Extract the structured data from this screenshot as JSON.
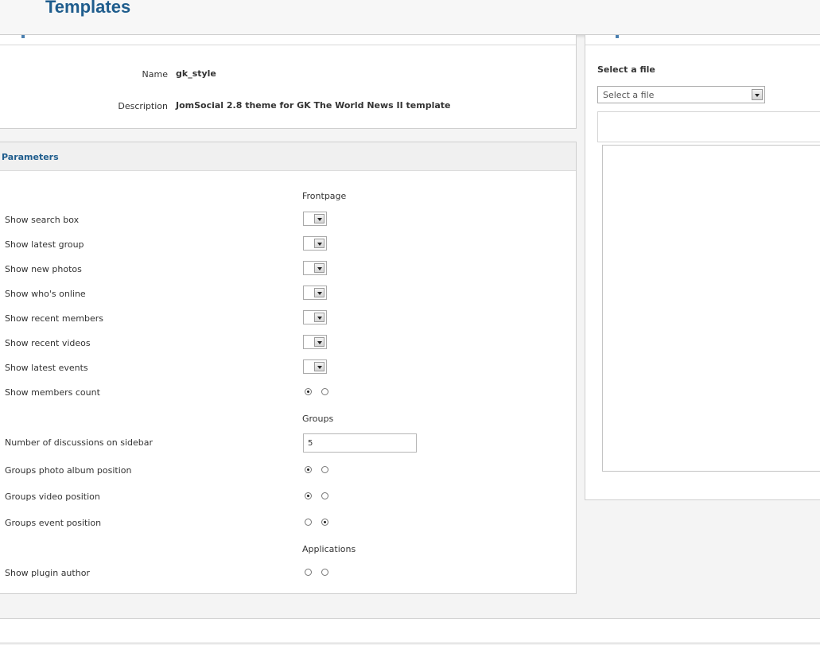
{
  "header": {
    "title": "Templates"
  },
  "details": {
    "name_label": "Name",
    "name_value": "gk_style",
    "description_label": "Description",
    "description_value": "JomSocial 2.8 theme for GK The World News II template"
  },
  "parameters": {
    "title": "Parameters",
    "frontpage_heading": "Frontpage",
    "frontpage": [
      {
        "label": "Show search box",
        "control": "select"
      },
      {
        "label": "Show latest group",
        "control": "select"
      },
      {
        "label": "Show new photos",
        "control": "select"
      },
      {
        "label": "Show who's online",
        "control": "select"
      },
      {
        "label": "Show recent members",
        "control": "select"
      },
      {
        "label": "Show recent videos",
        "control": "select"
      },
      {
        "label": "Show latest events",
        "control": "select"
      },
      {
        "label": "Show members count",
        "control": "radio",
        "checked": 1
      }
    ],
    "groups_heading": "Groups",
    "groups": [
      {
        "label": "Number of discussions on sidebar",
        "control": "text",
        "value": "5"
      },
      {
        "label": "Groups photo album position",
        "control": "radio",
        "checked": 1
      },
      {
        "label": "Groups video position",
        "control": "radio",
        "checked": 1
      },
      {
        "label": "Groups event position",
        "control": "radio",
        "checked": 2
      }
    ],
    "applications_heading": "Applications",
    "applications": [
      {
        "label": "Show plugin author",
        "control": "radio",
        "checked": 0
      }
    ]
  },
  "file_editor": {
    "select_label": "Select a file",
    "select_placeholder": "Select a file"
  }
}
